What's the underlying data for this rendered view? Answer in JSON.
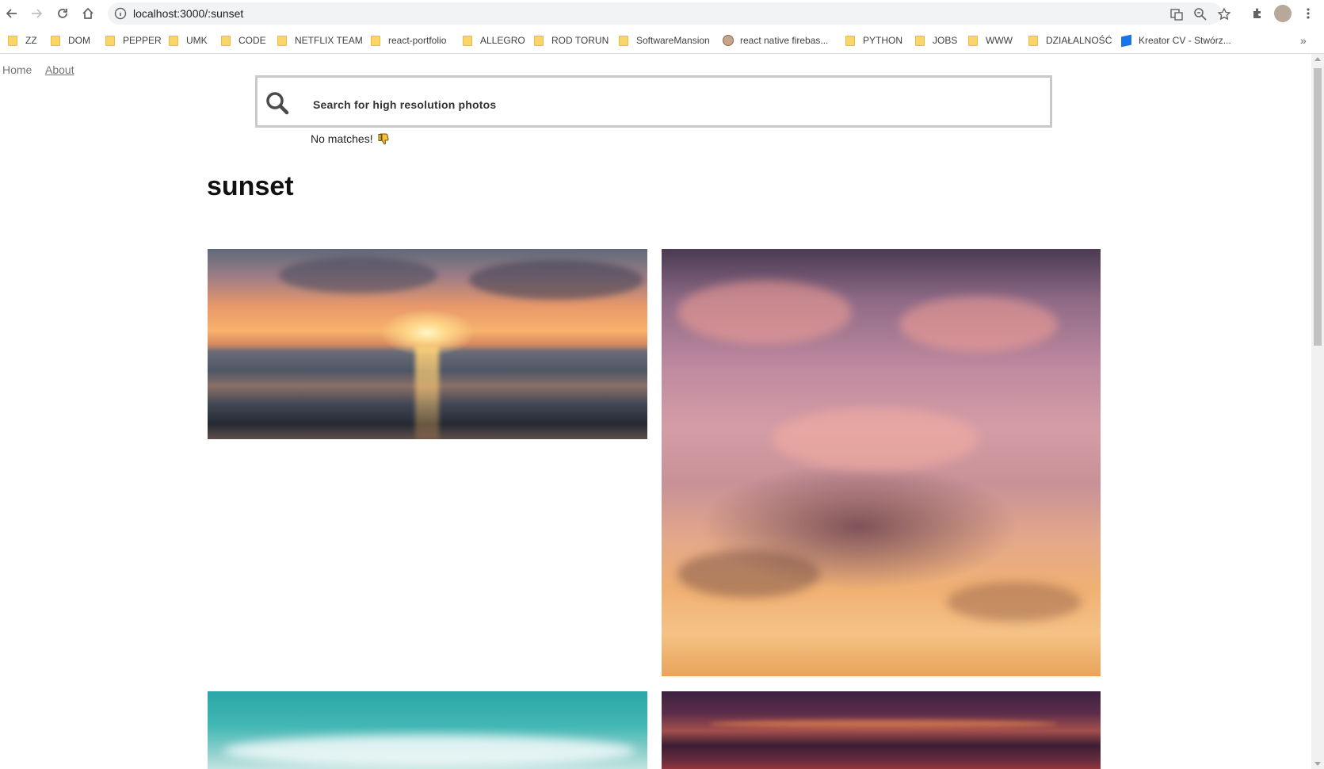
{
  "browser": {
    "url": "localhost:3000/:sunset",
    "bookmarks": [
      {
        "label": "ZZ",
        "icon": "folder-icon"
      },
      {
        "label": "DOM",
        "icon": "folder-icon"
      },
      {
        "label": "PEPPER",
        "icon": "folder-icon"
      },
      {
        "label": "UMK",
        "icon": "folder-icon"
      },
      {
        "label": "CODE",
        "icon": "folder-icon"
      },
      {
        "label": "NETFLIX TEAM",
        "icon": "folder-icon"
      },
      {
        "label": "react-portfolio",
        "icon": "folder-icon"
      },
      {
        "label": "ALLEGRO",
        "icon": "folder-icon"
      },
      {
        "label": "ROD TORUN",
        "icon": "folder-icon"
      },
      {
        "label": "SoftwareMansion",
        "icon": "folder-icon"
      },
      {
        "label": "react native firebas...",
        "icon": "site-avatar-icon"
      },
      {
        "label": "PYTHON",
        "icon": "folder-icon"
      },
      {
        "label": "JOBS",
        "icon": "folder-icon"
      },
      {
        "label": "WWW",
        "icon": "folder-icon"
      },
      {
        "label": "DZIAŁALNOŚĆ",
        "icon": "folder-icon"
      },
      {
        "label": "Kreator CV - Stwórz...",
        "icon": "site-logo-icon"
      }
    ],
    "more_label": "»"
  },
  "nav": {
    "home": "Home",
    "about": "About"
  },
  "search": {
    "placeholder": "Search for high resolution photos",
    "status": "No matches!"
  },
  "results": {
    "query_title": "sunset",
    "photos": [
      {
        "name": "sunset over sea"
      },
      {
        "name": "pink cloudy sky"
      },
      {
        "name": "teal sky with clouds"
      },
      {
        "name": "dark red sunset sky"
      }
    ]
  },
  "colors": {
    "folder": "#f9d56a",
    "search_border": "#c9c9c9",
    "nav_link": "#757575"
  }
}
